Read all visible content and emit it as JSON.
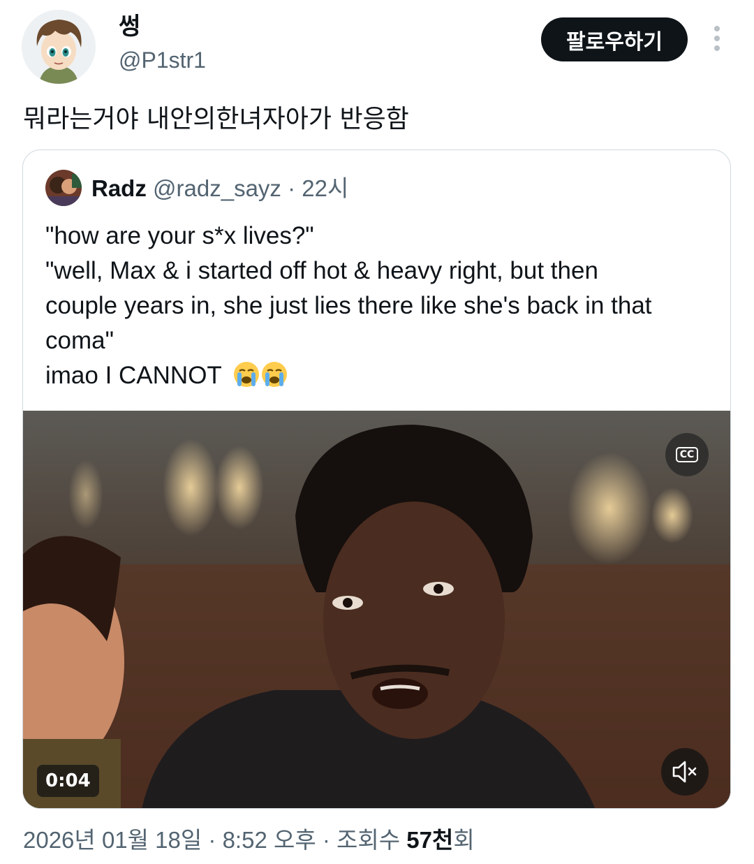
{
  "author": {
    "display_name": "썽",
    "handle": "@P1str1",
    "follow_label": "팔로우하기"
  },
  "tweet_text": "뭐라는거야 내안의한녀자아가 반응함",
  "quote": {
    "name": "Radz",
    "handle": "@radz_sayz",
    "separator": " · ",
    "time": "22시",
    "lines": [
      "\"how are your s*x lives?\"",
      "\"well, Max & i started off hot & heavy right, but then",
      "couple years in, she just lies there like she's back in that",
      "coma\"",
      "imao I CANNOT"
    ],
    "emoji": [
      "loudly-crying-face",
      "loudly-crying-face"
    ],
    "video": {
      "timestamp": "0:04",
      "cc_label": "CC"
    }
  },
  "footer": {
    "date": "2026년 01월 18일",
    "sep1": " · ",
    "time": "8:52 오후",
    "sep2": " · ",
    "views_label": "조회수 ",
    "views_count": "57천",
    "views_suffix": "회"
  },
  "colors": {
    "text_primary": "#0f1419",
    "text_secondary": "#536471",
    "border": "#cfd9de",
    "follow_bg": "#0f1419"
  }
}
